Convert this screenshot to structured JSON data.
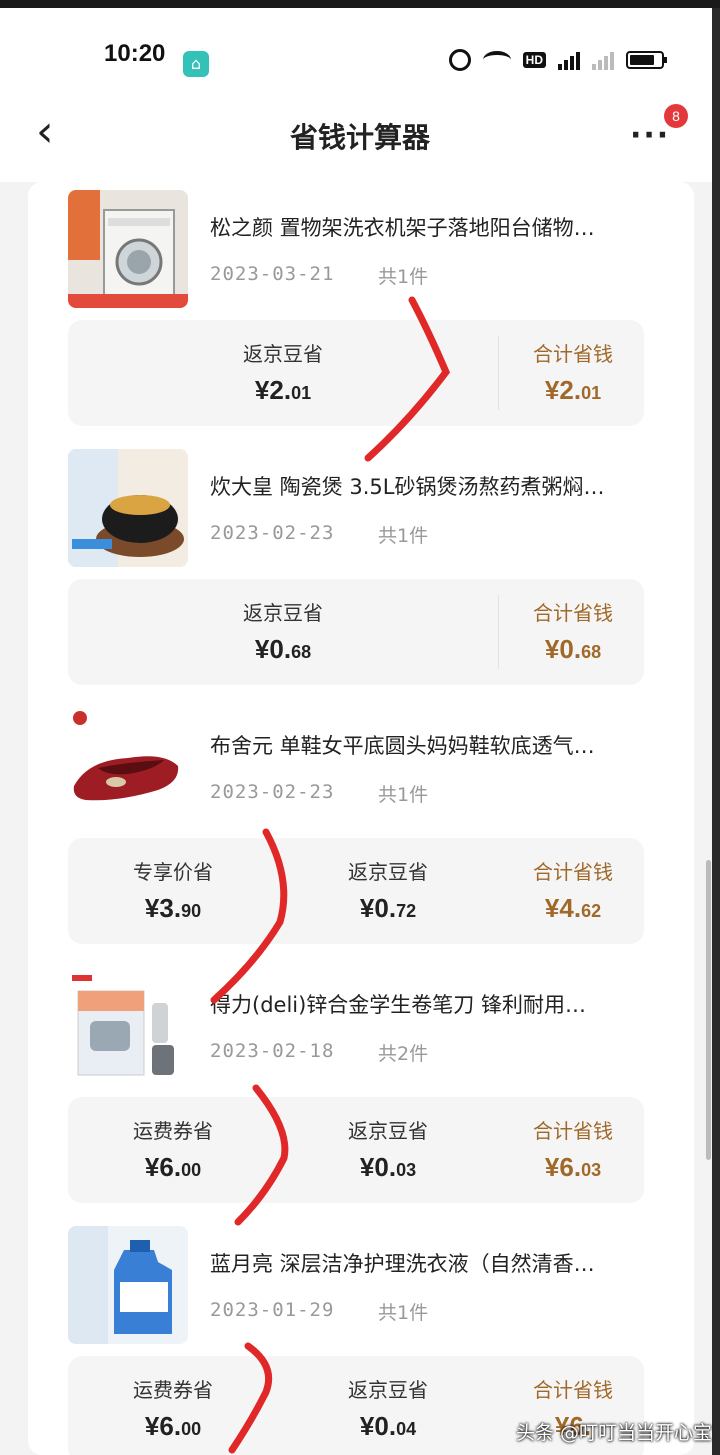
{
  "status_bar": {
    "time": "10:20",
    "hd_label": "HD",
    "app_icon": "home-app-icon"
  },
  "nav": {
    "back_icon": "chevron-left-icon",
    "title": "省钱计算器",
    "more_icon": "more-dots-icon",
    "badge_count": "8"
  },
  "orders": [
    {
      "title": "松之颜 置物架洗衣机架子落地阳台储物…",
      "date": "2023-03-21",
      "qty": "共1件",
      "savings": [
        {
          "label": "返京豆省",
          "int": "¥2.",
          "dec": "01"
        },
        {
          "label": "合计省钱",
          "int": "¥2.",
          "dec": "01"
        }
      ]
    },
    {
      "title": "炊大皇 陶瓷煲 3.5L砂锅煲汤熬药煮粥焖…",
      "date": "2023-02-23",
      "qty": "共1件",
      "savings": [
        {
          "label": "返京豆省",
          "int": "¥0.",
          "dec": "68"
        },
        {
          "label": "合计省钱",
          "int": "¥0.",
          "dec": "68"
        }
      ]
    },
    {
      "title": "布舍元 单鞋女平底圆头妈妈鞋软底透气…",
      "date": "2023-02-23",
      "qty": "共1件",
      "savings": [
        {
          "label": "专享价省",
          "int": "¥3.",
          "dec": "90"
        },
        {
          "label": "返京豆省",
          "int": "¥0.",
          "dec": "72"
        },
        {
          "label": "合计省钱",
          "int": "¥4.",
          "dec": "62"
        }
      ]
    },
    {
      "title": "得力(deli)锌合金学生卷笔刀 锋利耐用…",
      "date": "2023-02-18",
      "qty": "共2件",
      "savings": [
        {
          "label": "运费券省",
          "int": "¥6.",
          "dec": "00"
        },
        {
          "label": "返京豆省",
          "int": "¥0.",
          "dec": "03"
        },
        {
          "label": "合计省钱",
          "int": "¥6.",
          "dec": "03"
        }
      ]
    },
    {
      "title": "蓝月亮 深层洁净护理洗衣液（自然清香…",
      "date": "2023-01-29",
      "qty": "共1件",
      "savings": [
        {
          "label": "运费券省",
          "int": "¥6.",
          "dec": "00"
        },
        {
          "label": "返京豆省",
          "int": "¥0.",
          "dec": "04"
        },
        {
          "label": "合计省钱",
          "int": "¥6.",
          "dec": ""
        }
      ]
    }
  ],
  "colors": {
    "total_accent": "#a0692a",
    "badge_red": "#e4393c",
    "annotation_red": "#e02828"
  },
  "watermark": "头条 @叮叮当当开心宝"
}
